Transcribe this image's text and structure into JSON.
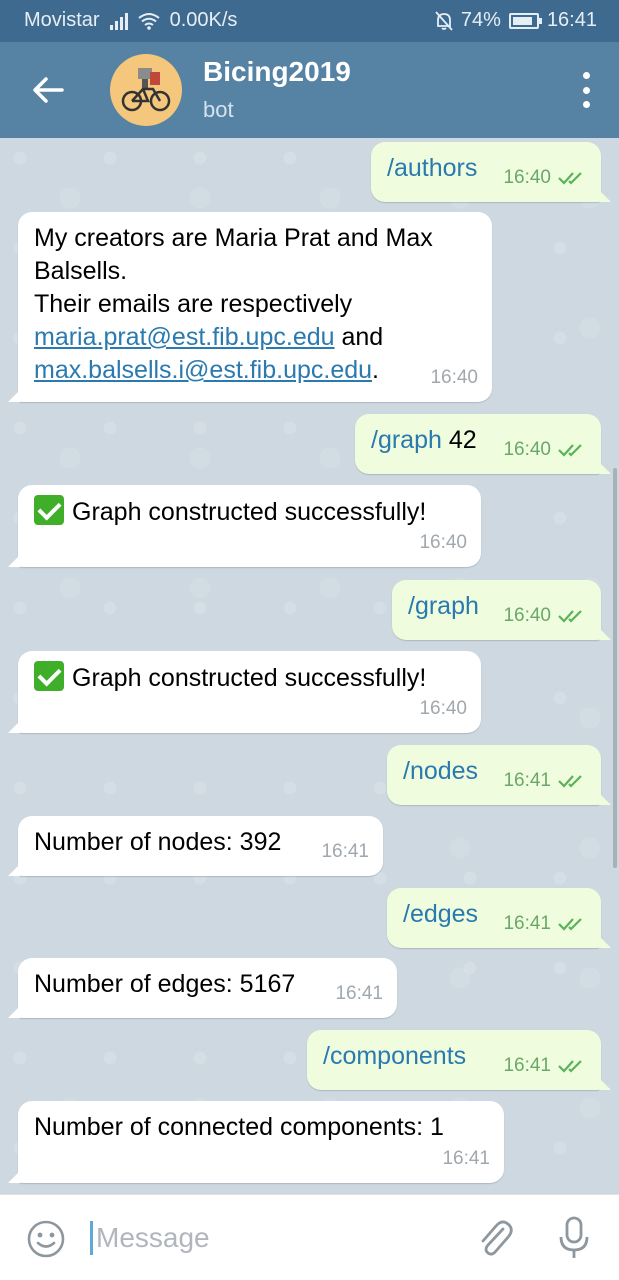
{
  "status": {
    "carrier": "Movistar",
    "speed": "0.00K/s",
    "battery": "74%",
    "time": "16:41"
  },
  "header": {
    "title": "Bicing2019",
    "subtitle": "bot"
  },
  "messages": [
    {
      "cmd": "/authors",
      "time": "16:40"
    },
    {
      "line1": "My creators are Maria Prat and Max Balsells.",
      "line2": "Their emails are respectively",
      "email1": "maria.prat@est.fib.upc.edu",
      "and": " and",
      "email2": "max.balsells.i@est.fib.upc.edu",
      "end": ".",
      "time": "16:40"
    },
    {
      "cmd": "/graph",
      "arg": " 42",
      "time": "16:40"
    },
    {
      "text": "Graph constructed successfully!",
      "time": "16:40"
    },
    {
      "cmd": "/graph",
      "time": "16:40"
    },
    {
      "text": "Graph constructed successfully!",
      "time": "16:40"
    },
    {
      "cmd": "/nodes",
      "time": "16:41"
    },
    {
      "text": "Number of nodes: 392",
      "time": "16:41"
    },
    {
      "cmd": "/edges",
      "time": "16:41"
    },
    {
      "text": "Number of edges: 5167",
      "time": "16:41"
    },
    {
      "cmd": "/components",
      "time": "16:41"
    },
    {
      "text": "Number of connected components: 1",
      "time": "16:41"
    }
  ],
  "input": {
    "placeholder": "Message"
  },
  "icons": {
    "back": "arrow-left-icon",
    "menu": "more-vertical-icon",
    "emoji": "smile-icon",
    "attach": "paperclip-icon",
    "mic": "microphone-icon",
    "read": "double-check-icon",
    "success": "check-mark-button-emoji"
  },
  "colors": {
    "header": "#5682a3",
    "statusbar": "#3f6a8f",
    "incoming": "#ffffff",
    "outgoing": "#effdde",
    "command": "#2a7ab0",
    "emoji_check": "#3fae29"
  }
}
